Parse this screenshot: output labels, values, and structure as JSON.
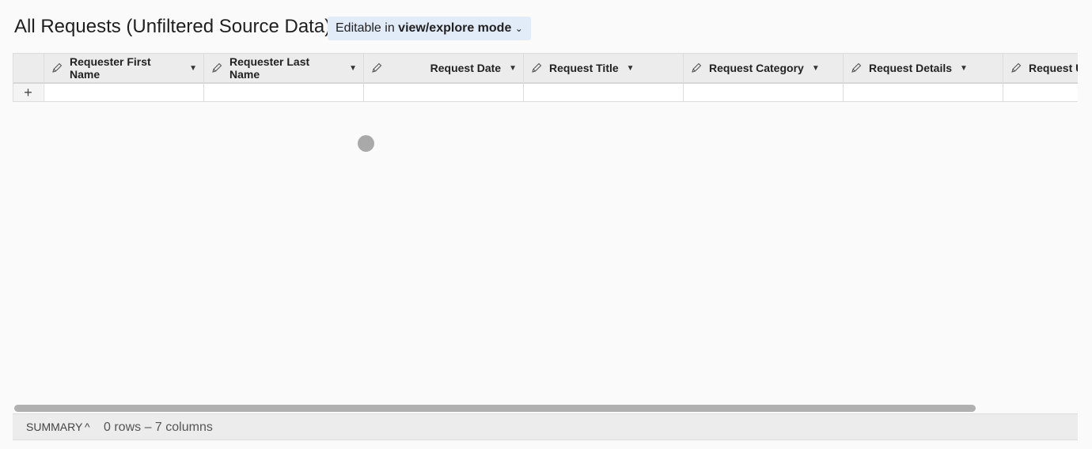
{
  "header": {
    "title": "All Requests (Unfiltered Source Data)",
    "mode_prefix": "Editable in",
    "mode_value": "view/explore mode",
    "mode_chevron": "⌄"
  },
  "table": {
    "add_row_label": "+",
    "columns": [
      {
        "label": "Requester First Name",
        "align": "left"
      },
      {
        "label": "Requester Last Name",
        "align": "left"
      },
      {
        "label": "Request Date",
        "align": "right"
      },
      {
        "label": "Request Title",
        "align": "left"
      },
      {
        "label": "Request Category",
        "align": "left"
      },
      {
        "label": "Request Details",
        "align": "left"
      },
      {
        "label": "Request U",
        "align": "left"
      }
    ]
  },
  "summary": {
    "label": "SUMMARY",
    "toggle": "^",
    "count": "0 rows – 7 columns"
  },
  "colors": {
    "mode_bg": "#e2ebf8",
    "header_bg": "#ececec"
  }
}
